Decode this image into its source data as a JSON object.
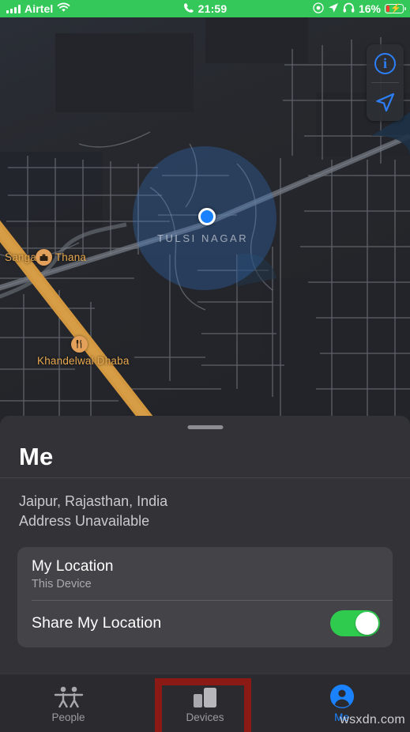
{
  "status_bar": {
    "carrier": "Airtel",
    "signal_icon": "signal-bars-icon",
    "wifi_icon": "wifi-icon",
    "call_icon": "phone-call-icon",
    "time": "21:59",
    "record_icon": "screen-record-icon",
    "location_icon": "location-arrow-icon",
    "headphones_icon": "headphones-icon",
    "battery_percent": "16%",
    "battery_icon": "battery-charging-icon",
    "background_color": "#34c759"
  },
  "map": {
    "area_label": "TULSI NAGAR",
    "pois": [
      {
        "name": "Sanganer Thana",
        "icon": "government-building-icon"
      },
      {
        "name": "Khandelwal Dhaba",
        "icon": "restaurant-icon"
      }
    ],
    "controls": {
      "info_label": "i",
      "info_icon": "info-circle-icon",
      "locate_icon": "navigate-arrow-icon"
    },
    "user_location_icon": "blue-location-dot",
    "accent_color": "#1a82ff",
    "highway_color": "#d2973f"
  },
  "sheet": {
    "title": "Me",
    "address_line_1": "Jaipur, Rajasthan, India",
    "address_line_2": "Address Unavailable",
    "card": {
      "my_location_label": "My Location",
      "my_location_sub": "This Device",
      "share_label": "Share My Location",
      "share_enabled": true,
      "toggle_on_color": "#2fcb4f"
    }
  },
  "tab_bar": {
    "tabs": [
      {
        "label": "People",
        "icon": "two-people-icon",
        "active": false
      },
      {
        "label": "Devices",
        "icon": "devices-icon",
        "active": false
      },
      {
        "label": "Me",
        "icon": "person-circle-icon",
        "active": true
      }
    ],
    "highlight_color": "#8b1a14",
    "active_color": "#1a82ff"
  },
  "watermark": "wsxdn.com"
}
